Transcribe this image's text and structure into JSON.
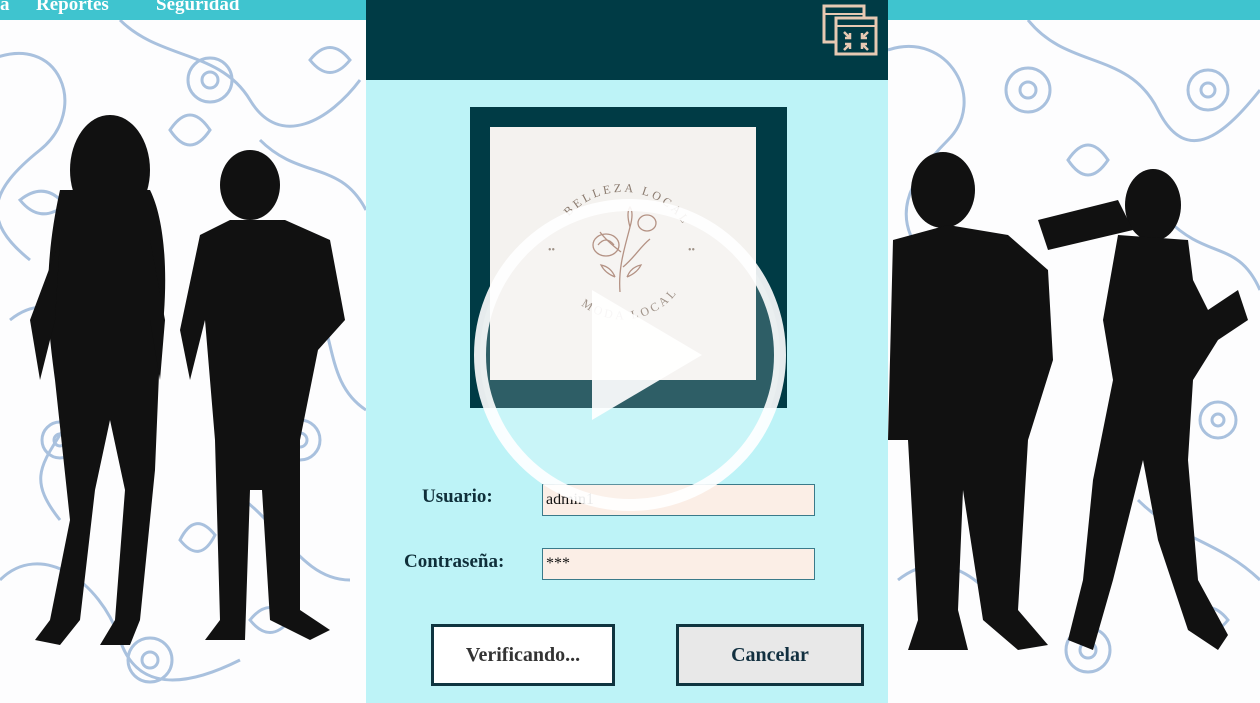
{
  "menu": {
    "items": [
      {
        "label": "a"
      },
      {
        "label": "Reportes"
      },
      {
        "label": "Seguridad"
      }
    ]
  },
  "logo": {
    "top_text": "BELLEZA LOCAL",
    "bottom_text": "MODA LOCAL"
  },
  "form": {
    "user_label": "Usuario:",
    "user_value": "admin1",
    "password_label": "Contraseña:",
    "password_value": "***"
  },
  "buttons": {
    "verify_label": "Verificando...",
    "cancel_label": "Cancelar"
  },
  "colors": {
    "menubar": "#3fc4cf",
    "dialog_bg": "#bdf3f7",
    "header": "#003b45",
    "field_bg": "#fbeee6"
  },
  "icons": {
    "restore": "restore-window-icon",
    "play": "play-icon"
  }
}
